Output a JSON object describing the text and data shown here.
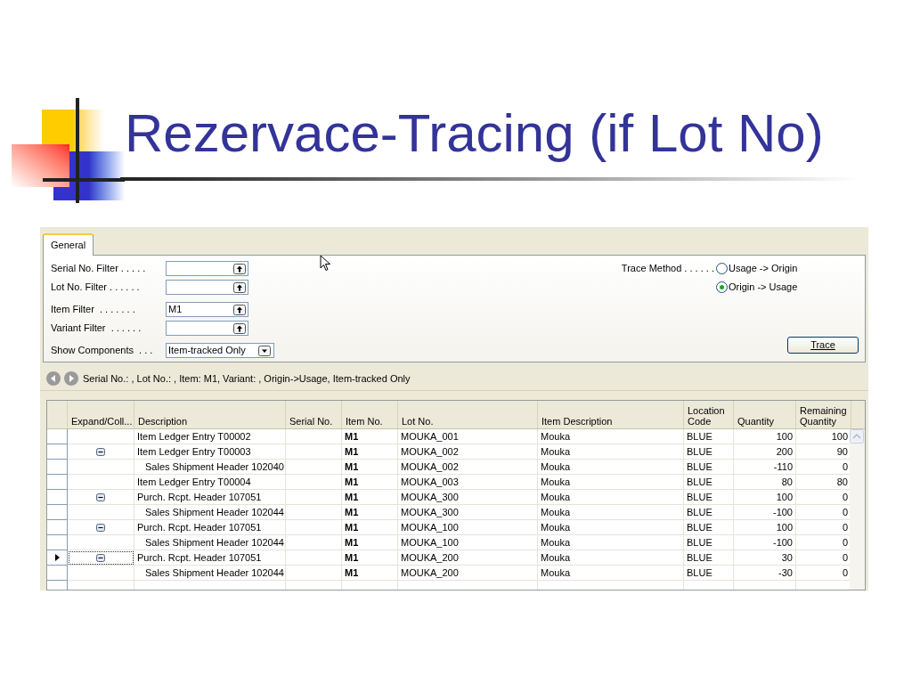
{
  "slide_title": "Rezervace-Tracing (if Lot No)",
  "tabs": [
    {
      "label": "General",
      "selected": true
    }
  ],
  "filters": [
    {
      "kind": "lookup",
      "label": "Serial No. Filter . . . . ."
    },
    {
      "kind": "lookup",
      "label": "Lot No. Filter . . . . . ."
    },
    {
      "kind": "lookup",
      "label": "Item Filter  . . . . . . .",
      "value": "M1"
    },
    {
      "kind": "lookup",
      "label": "Variant Filter  . . . . . ."
    },
    {
      "kind": "dropdown",
      "label": "Show Components  . . .",
      "value": "Item-tracked Only"
    }
  ],
  "trace_method": {
    "label": "Trace Method . . . . . .",
    "options": [
      {
        "label": "Usage -> Origin",
        "selected": false
      },
      {
        "label": "Origin -> Usage",
        "selected": true
      }
    ]
  },
  "trace_button": "Trace",
  "navigation_text": "Serial No.: , Lot No.: , Item: M1, Variant: , Origin->Usage, Item-tracked Only",
  "table": {
    "columns": [
      "Expand/Coll...",
      "Description",
      "Serial No.",
      "Item No.",
      "Lot No.",
      "Item Description",
      "Location Code",
      "Quantity",
      "Remaining Quantity"
    ],
    "rows": [
      {
        "description": "Item Ledger Entry T00002",
        "item_no": "M1",
        "lot_no": "MOUKA_001",
        "item_description": "Mouka",
        "location_code": "BLUE",
        "quantity": "100",
        "remaining_quantity": "100",
        "selected": false
      },
      {
        "description": "Item Ledger Entry T00003",
        "item_no": "M1",
        "lot_no": "MOUKA_002",
        "item_description": "Mouka",
        "location_code": "BLUE",
        "quantity": "200",
        "remaining_quantity": "90",
        "selected": false,
        "expanded": true,
        "children": [
          {
            "description": "Sales Shipment Header 102040",
            "item_no": "M1",
            "lot_no": "MOUKA_002",
            "item_description": "Mouka",
            "location_code": "BLUE",
            "quantity": "-110",
            "remaining_quantity": "0",
            "selected": false
          }
        ]
      },
      {
        "description": "Item Ledger Entry T00004",
        "item_no": "M1",
        "lot_no": "MOUKA_003",
        "item_description": "Mouka",
        "location_code": "BLUE",
        "quantity": "80",
        "remaining_quantity": "80",
        "selected": false
      },
      {
        "description": "Purch. Rcpt. Header 107051",
        "item_no": "M1",
        "lot_no": "MOUKA_300",
        "item_description": "Mouka",
        "location_code": "BLUE",
        "quantity": "100",
        "remaining_quantity": "0",
        "selected": false,
        "expanded": true,
        "children": [
          {
            "description": "Sales Shipment Header 102044",
            "item_no": "M1",
            "lot_no": "MOUKA_300",
            "item_description": "Mouka",
            "location_code": "BLUE",
            "quantity": "-100",
            "remaining_quantity": "0",
            "selected": false
          }
        ]
      },
      {
        "description": "Purch. Rcpt. Header 107051",
        "item_no": "M1",
        "lot_no": "MOUKA_100",
        "item_description": "Mouka",
        "location_code": "BLUE",
        "quantity": "100",
        "remaining_quantity": "0",
        "selected": false,
        "expanded": true,
        "children": [
          {
            "description": "Sales Shipment Header 102044",
            "item_no": "M1",
            "lot_no": "MOUKA_100",
            "item_description": "Mouka",
            "location_code": "BLUE",
            "quantity": "-100",
            "remaining_quantity": "0",
            "selected": false
          }
        ]
      },
      {
        "description": "Purch. Rcpt. Header 107051",
        "item_no": "M1",
        "lot_no": "MOUKA_200",
        "item_description": "Mouka",
        "location_code": "BLUE",
        "quantity": "30",
        "remaining_quantity": "0",
        "selected": true,
        "expanded": true,
        "children": [
          {
            "description": "Sales Shipment Header 102044",
            "item_no": "M1",
            "lot_no": "MOUKA_200",
            "item_description": "Mouka",
            "location_code": "BLUE",
            "quantity": "-30",
            "remaining_quantity": "0",
            "selected": false
          }
        ]
      }
    ]
  }
}
